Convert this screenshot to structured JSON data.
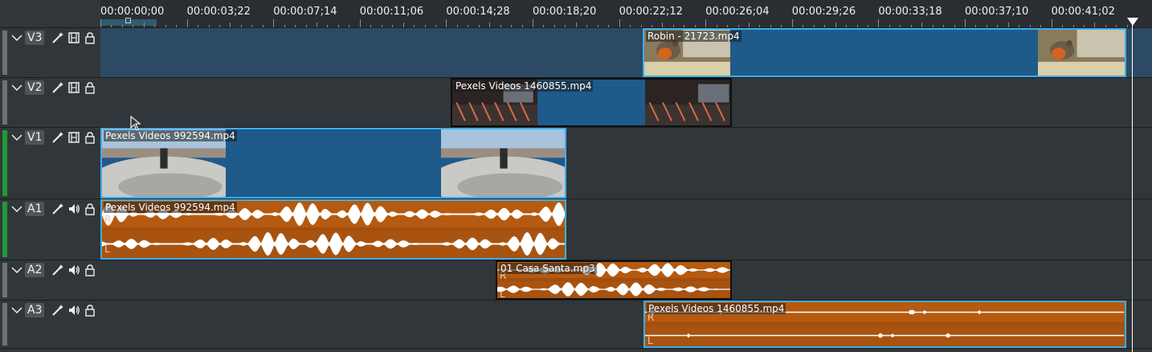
{
  "ruler": {
    "labels": [
      "00:00:00;00",
      "00:00:03;22",
      "00:00:07;14",
      "00:00:11;06",
      "00:00:14;28",
      "00:00:18;20",
      "00:00:22;12",
      "00:00:26;04",
      "00:00:29;26",
      "00:00:33;18",
      "00:00:37;10",
      "00:00:41;02"
    ]
  },
  "tracks": [
    {
      "name": "V3",
      "kind": "video",
      "selected": true,
      "strip": "#6e7276",
      "clips": [
        {
          "label": "Robin - 21723.mp4",
          "selected": true,
          "thumbs": [
            "robin",
            "robin"
          ]
        }
      ]
    },
    {
      "name": "V2",
      "kind": "video",
      "selected": false,
      "strip": "#6e7276",
      "clips": [
        {
          "label": "Pexels Videos 1460855.mp4",
          "selected": false,
          "thumbs": [
            "street",
            "street"
          ]
        }
      ]
    },
    {
      "name": "V1",
      "kind": "video",
      "selected": false,
      "strip": "#1f9b34",
      "clips": [
        {
          "label": "Pexels Videos 992594.mp4",
          "selected": true,
          "thumbs": [
            "skate",
            "skate"
          ]
        }
      ]
    },
    {
      "name": "A1",
      "kind": "audio",
      "selected": false,
      "strip": "#1f9b34",
      "clips": [
        {
          "label": "Pexels Videos 992594.mp4",
          "selected": true,
          "channels": [
            "R",
            "L"
          ]
        }
      ]
    },
    {
      "name": "A2",
      "kind": "audio",
      "selected": false,
      "strip": "#6e7276",
      "clips": [
        {
          "label": "01 Casa Santa.mp3",
          "selected": false,
          "channels": [
            "R",
            "L"
          ]
        }
      ]
    },
    {
      "name": "A3",
      "kind": "audio",
      "selected": false,
      "strip": "#6e7276",
      "clips": [
        {
          "label": "Pexels Videos 1460855.mp4",
          "selected": true,
          "channels": [
            "R",
            "L"
          ]
        }
      ]
    }
  ],
  "icons": {
    "collapse": "chevron-down-icon",
    "effects": "magic-wand-icon",
    "video": "film-icon",
    "audio": "speaker-icon",
    "lock": "lock-icon"
  },
  "colors": {
    "accent": "#3daee9",
    "video_clip": "#1e5a8a",
    "audio_clip": "#a14e0e"
  }
}
